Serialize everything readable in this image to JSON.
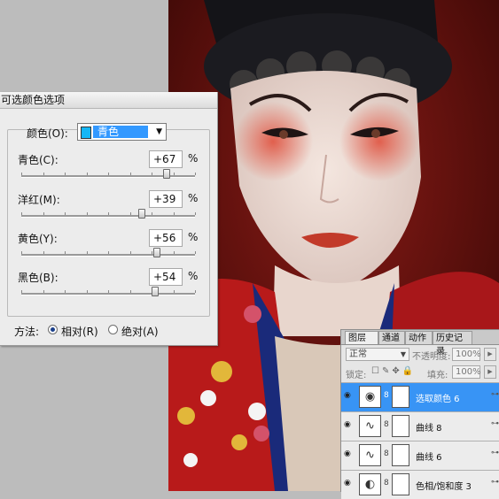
{
  "dialog": {
    "title": "可选颜色选项",
    "colors_label": "颜色(O):",
    "colors_value": "青色",
    "swatch_color": "#15b6f5",
    "sliders": [
      {
        "label": "青色(C):",
        "value": "+67",
        "unit": "%",
        "percent": 67
      },
      {
        "label": "洋红(M):",
        "value": "+39",
        "unit": "%",
        "percent": 39
      },
      {
        "label": "黄色(Y):",
        "value": "+56",
        "unit": "%",
        "percent": 56
      },
      {
        "label": "黑色(B):",
        "value": "+54",
        "unit": "%",
        "percent": 54
      }
    ],
    "method_label": "方法:",
    "method_relative": "相对(R)",
    "method_absolute": "绝对(A)",
    "method_selected": "relative"
  },
  "layers_panel": {
    "tabs": [
      {
        "label": "图层 ×",
        "active": true
      },
      {
        "label": "通道",
        "active": false
      },
      {
        "label": "动作",
        "active": false
      },
      {
        "label": "历史记录",
        "active": false
      }
    ],
    "blend_mode": "正常",
    "opacity_label": "不透明度:",
    "opacity_value": "100%",
    "lock_label": "锁定:",
    "fill_label": "填充:",
    "fill_value": "100%",
    "layers": [
      {
        "name": "选取颜色 6",
        "selected": true,
        "icon": "selective-color-icon"
      },
      {
        "name": "曲线 8",
        "selected": false,
        "icon": "curves-icon"
      },
      {
        "name": "曲线 6",
        "selected": false,
        "icon": "curves-icon"
      },
      {
        "name": "色相/饱和度 3",
        "selected": false,
        "icon": "hue-saturation-icon"
      }
    ]
  },
  "colors": {
    "selection": "#3399ff",
    "layer_selected": "#3894f5",
    "costume_red": "#b81a1a"
  }
}
